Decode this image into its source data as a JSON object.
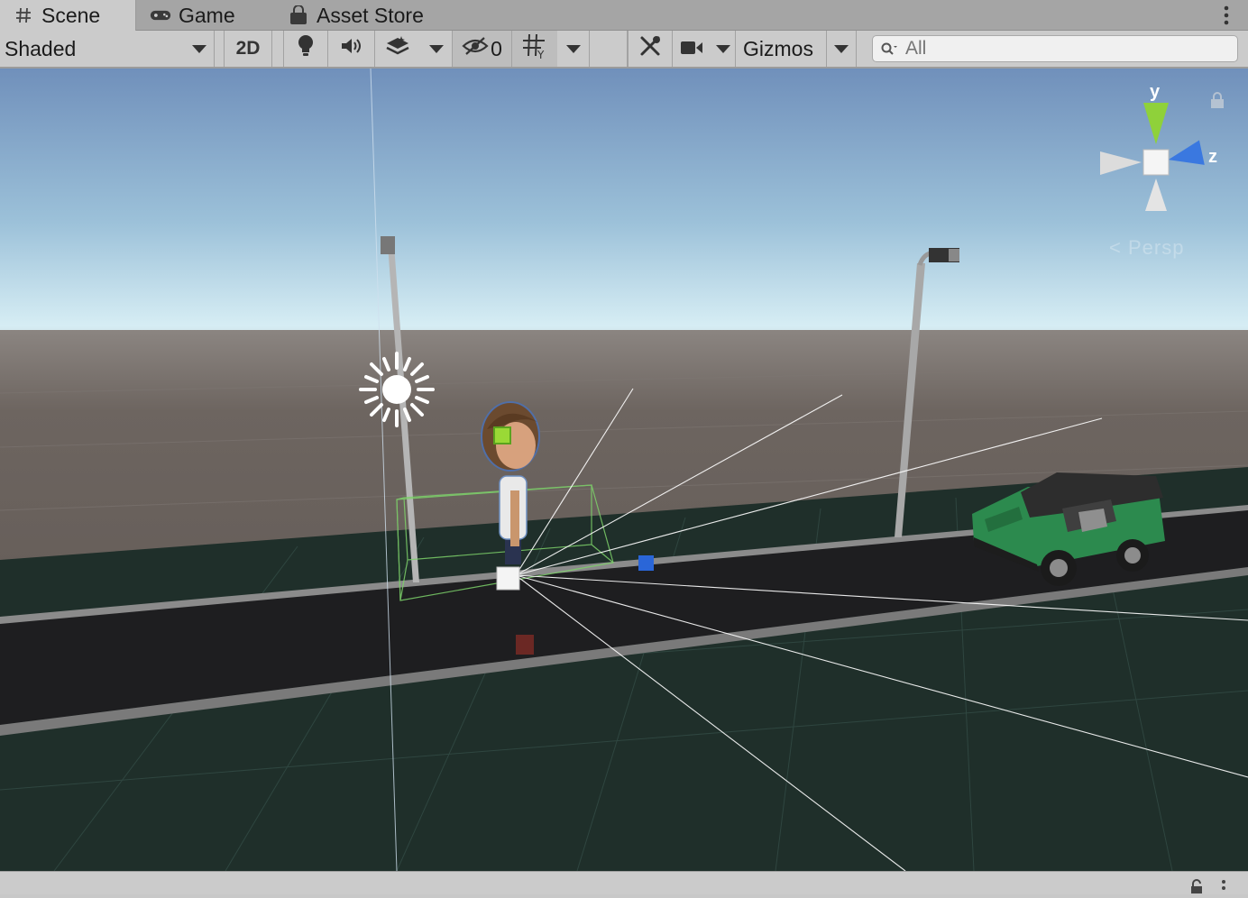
{
  "tabs": [
    {
      "label": "Scene",
      "icon": "hash-grid-icon",
      "active": true
    },
    {
      "label": "Game",
      "icon": "gamepad-icon",
      "active": false
    },
    {
      "label": "Asset Store",
      "icon": "shopping-bag-icon",
      "active": false
    }
  ],
  "toolbar": {
    "shading_mode": "Shaded",
    "mode_2d_label": "2D",
    "hidden_count": "0",
    "gizmos_label": "Gizmos",
    "search_placeholder": "All"
  },
  "gizmo": {
    "y_label": "y",
    "z_label": "z",
    "projection_label": "Persp"
  },
  "colors": {
    "sky_top": "#7495bd",
    "horizon": "#d9eef5",
    "ground_far": "#6c635e",
    "grid_plane": "#1f2f2a",
    "road": "#1e1e20",
    "car_green": "#2c8a4e",
    "y_axis": "#8fd13a",
    "z_axis": "#3a78e0"
  }
}
